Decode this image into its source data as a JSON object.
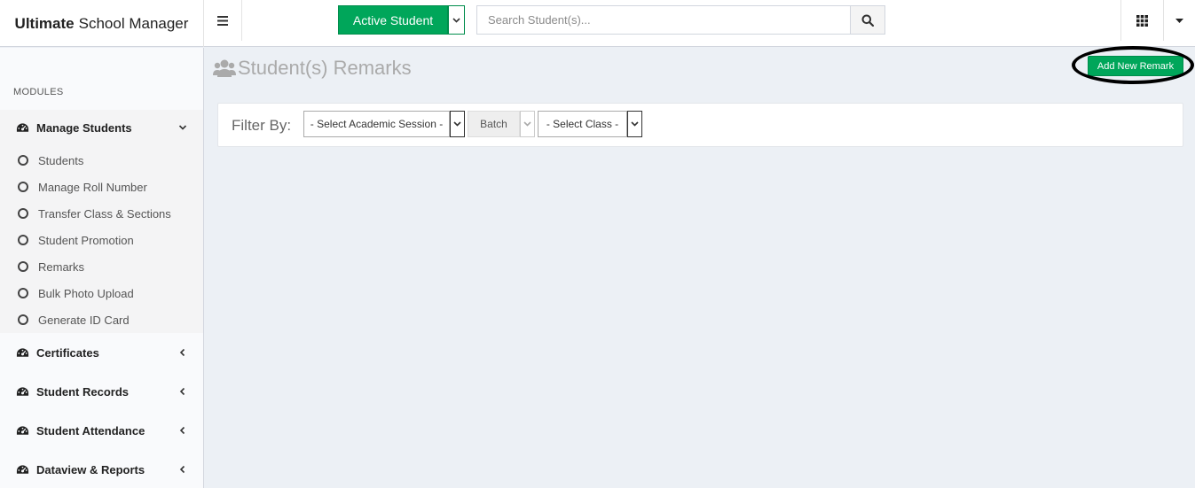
{
  "brand": {
    "bold": "Ultimate",
    "rest": "School Manager"
  },
  "header": {
    "active_student_label": "Active Student",
    "search_placeholder": "Search Student(s)..."
  },
  "sidebar": {
    "section_label": "MODULES",
    "open_menu": {
      "label": "Manage Students",
      "items": [
        {
          "label": "Students"
        },
        {
          "label": "Manage Roll Number"
        },
        {
          "label": "Transfer Class & Sections"
        },
        {
          "label": "Student Promotion"
        },
        {
          "label": "Remarks"
        },
        {
          "label": "Bulk Photo Upload"
        },
        {
          "label": "Generate ID Card"
        }
      ]
    },
    "menus": [
      {
        "label": "Certificates"
      },
      {
        "label": "Student Records"
      },
      {
        "label": "Student Attendance"
      },
      {
        "label": "Dataview & Reports"
      }
    ]
  },
  "page": {
    "title": "Student(s) Remarks",
    "add_button_label": "Add New Remark"
  },
  "filter": {
    "label": "Filter By:",
    "session_value": "- Select Academic Session -",
    "batch_value": "Batch",
    "class_value": "- Select Class -"
  },
  "colors": {
    "accent_green": "#00a65a",
    "sidebar_bg": "#f9fafc",
    "content_bg": "#ecf0f5"
  }
}
